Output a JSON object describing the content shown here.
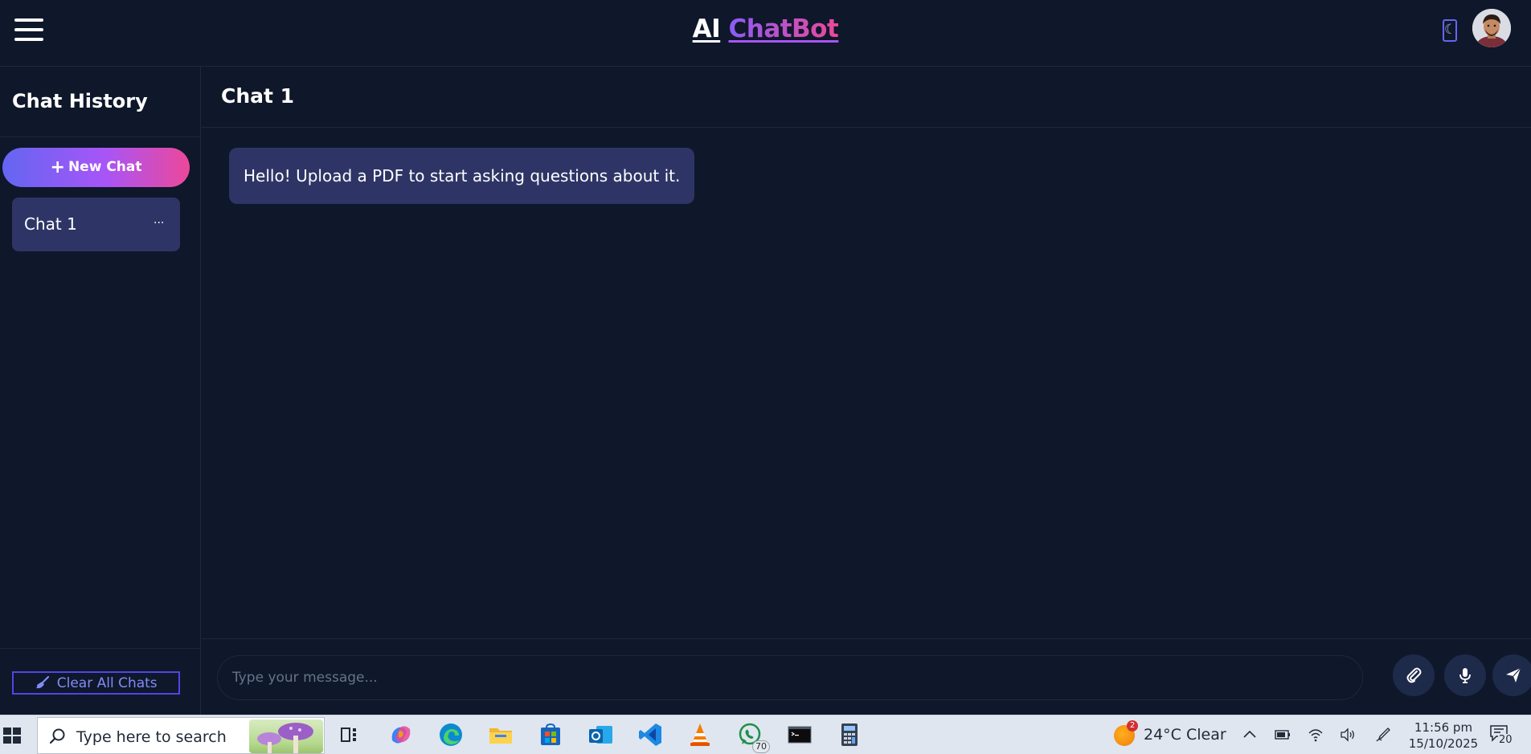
{
  "header": {
    "brand_ai": "AI",
    "brand_chatbot": "ChatBot",
    "theme_toggle_glyph": "☾"
  },
  "sidebar": {
    "title": "Chat History",
    "new_chat_label": "New Chat",
    "chats": [
      {
        "label": "Chat 1",
        "more": "..."
      }
    ],
    "clear_all_label": "Clear All Chats"
  },
  "main": {
    "chat_title": "Chat 1",
    "messages": [
      {
        "role": "bot",
        "text": "Hello! Upload a PDF to start asking questions about it."
      }
    ],
    "input_placeholder": "Type your message...",
    "input_value": ""
  },
  "taskbar": {
    "search_placeholder": "Type here to search",
    "whatsapp_badge": "70",
    "weather_badge": "2",
    "weather": "24°C  Clear",
    "time": "11:56 pm",
    "date": "15/10/2025",
    "notification_count": "20"
  },
  "colors": {
    "background": "#0f172a",
    "accent_purple": "#a855f7",
    "accent_pink": "#ec4899",
    "accent_indigo": "#6366f1",
    "bubble": "#2e3566"
  },
  "icons": [
    "hamburger-menu-icon",
    "moon-icon",
    "user-avatar",
    "plus-icon",
    "broom-icon",
    "paperclip-icon",
    "microphone-icon",
    "send-icon",
    "windows-start-icon",
    "search-icon"
  ]
}
